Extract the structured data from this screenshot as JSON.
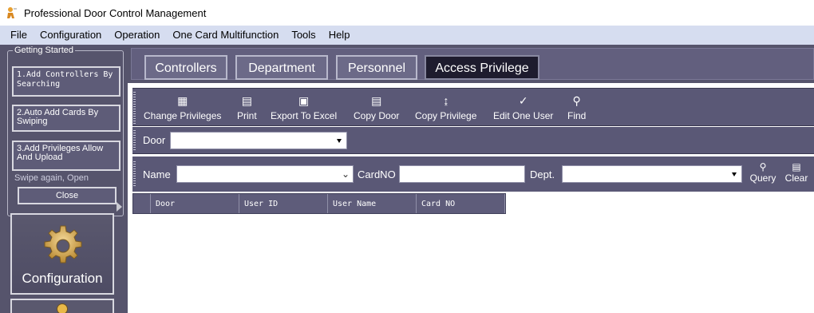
{
  "window": {
    "title": "Professional Door Control Management",
    "app_icon": "key-person-icon"
  },
  "menu": [
    "File",
    "Configuration",
    "Operation",
    "One Card Multifunction",
    "Tools",
    "Help"
  ],
  "getting_started": {
    "legend": "Getting Started",
    "step1": "1.Add Controllers By Searching",
    "step2": "2.Auto Add Cards By Swiping",
    "step3": "3.Add Privileges Allow And Upload",
    "swipe_hint": "Swipe again, Open",
    "close": "Close"
  },
  "nav": {
    "configuration_label": "Configuration",
    "configuration_icon": "gear-icon"
  },
  "tabs": [
    "Controllers",
    "Department",
    "Personnel",
    "Access Privilege"
  ],
  "active_tab": "Access Privilege",
  "toolbar": [
    {
      "label": "Change Privileges",
      "icon": "change-privileges-icon"
    },
    {
      "label": "Print",
      "icon": "printer-icon"
    },
    {
      "label": "Export To Excel",
      "icon": "excel-icon"
    },
    {
      "label": "Copy Door",
      "icon": "copy-door-icon"
    },
    {
      "label": "Copy Privilege",
      "icon": "copy-privilege-icon"
    },
    {
      "label": "Edit One User",
      "icon": "edit-user-icon"
    },
    {
      "label": "Find",
      "icon": "search-icon"
    }
  ],
  "door_filter": {
    "label": "Door",
    "value": ""
  },
  "filters": {
    "name_label": "Name",
    "name_value": "",
    "cardno_label": "CardNO",
    "cardno_value": "",
    "dept_label": "Dept.",
    "dept_value": "",
    "query": "Query",
    "clear": "Clear"
  },
  "grid": {
    "columns": [
      "Door",
      "User ID",
      "User Name",
      "Card NO"
    ],
    "rows": []
  },
  "colors": {
    "panel": "#56546c",
    "menu": "#d6ddf0",
    "active_tab": "#1e1c2e"
  }
}
